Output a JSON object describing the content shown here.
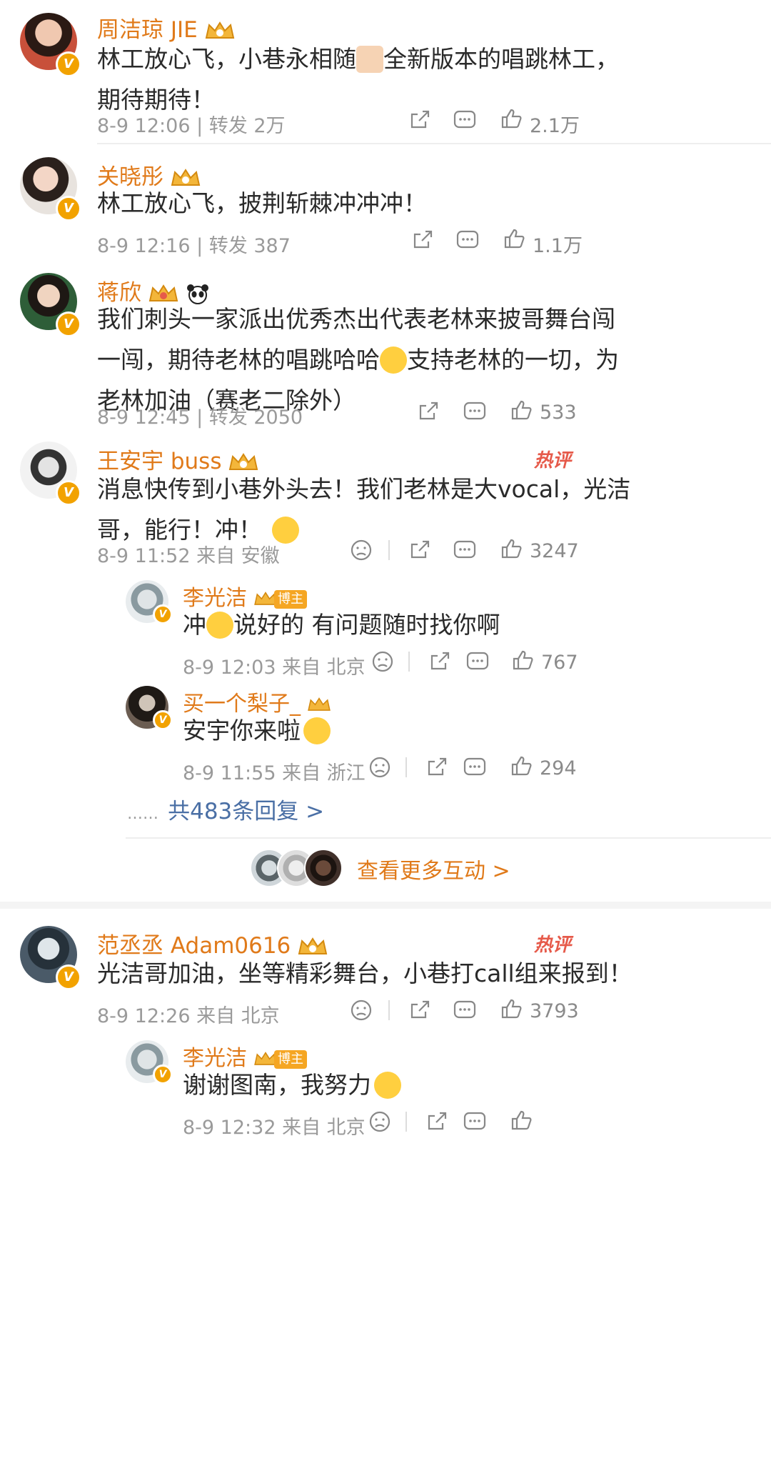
{
  "comments": [
    {
      "name": "周洁琼 JIE",
      "text1": "林工放心飞，小巷永相随",
      "text1b": "全新版本的唱跳林工，",
      "text2": "期待期待！",
      "meta": "8-9 12:06 | 转发 2万",
      "likes": "2.1万"
    },
    {
      "name": "关晓彤",
      "text1": "林工放心飞，披荆斩棘冲冲冲！",
      "meta": "8-9 12:16 | 转发 387",
      "likes": "1.1万"
    },
    {
      "name": "蒋欣",
      "text1": "我们刺头一家派出优秀杰出代表老林来披哥舞台闯",
      "text2a": "一闯，期待老林的唱跳哈哈",
      "text2b": "支持老林的一切，为",
      "text3": "老林加油（赛老二除外）",
      "meta": "8-9 12:45 | 转发 2050",
      "likes": "533"
    },
    {
      "name": "王安宇 buss",
      "hot": "热评",
      "text1": "消息快传到小巷外头去！我们老林是大vocal，光洁",
      "text2": "哥，能行！冲！",
      "meta": "8-9 11:52 来自 安徽",
      "likes": "3247",
      "replies": [
        {
          "name": "李光洁",
          "badge": "博主",
          "text_a": "冲",
          "text_b": "说好的 有问题随时找你啊",
          "meta": "8-9 12:03 来自 北京",
          "likes": "767"
        },
        {
          "name": "买一个梨子_",
          "text_a": "安宇你来啦",
          "meta": "8-9 11:55 来自 浙江",
          "likes": "294"
        }
      ],
      "more_replies": "共483条回复 >",
      "more_dots": "……"
    },
    {
      "name": "范丞丞 Adam0616",
      "hot": "热评",
      "text1": "光洁哥加油，坐等精彩舞台，小巷打call组来报到！",
      "meta": "8-9 12:26 来自 北京",
      "likes": "3793",
      "replies": [
        {
          "name": "李光洁",
          "badge": "博主",
          "text_a": "谢谢图南，我努力",
          "meta": "8-9 12:32 来自 北京",
          "likes": ""
        }
      ]
    }
  ],
  "more_interactions": "查看更多互动 >",
  "icons": {
    "repost": "repost-icon",
    "comment": "comment-icon",
    "like": "like-icon",
    "dislike": "dislike-icon",
    "crown": "crown-icon",
    "verified": "verified-badge-icon"
  },
  "colors": {
    "name": "#e07a1a",
    "link": "#4a6fa5",
    "hot": "#e65a4a",
    "badge": "#f2a200"
  }
}
